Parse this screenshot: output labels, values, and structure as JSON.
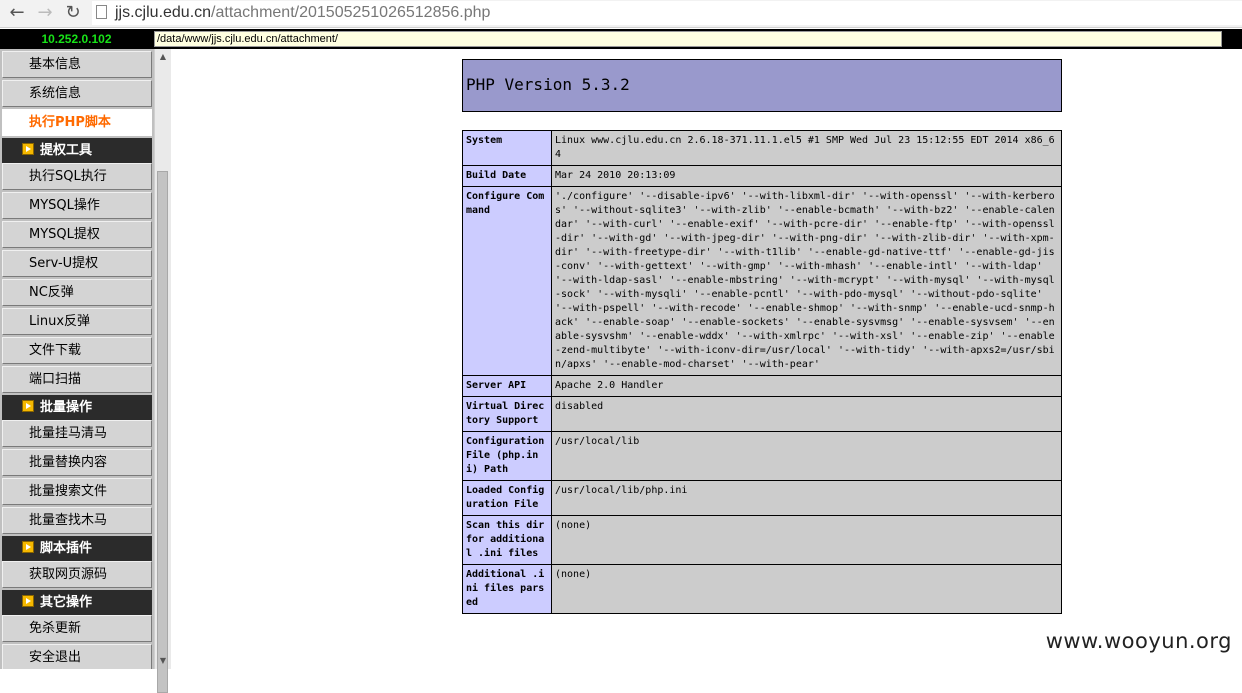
{
  "browser": {
    "url_host": "jjs.cjlu.edu.cn",
    "url_path": "/attachment/201505251026512856.php",
    "back_icon": "back-arrow-icon",
    "forward_icon": "forward-arrow-icon",
    "reload_icon": "reload-icon"
  },
  "topbar": {
    "ip": "10.252.0.102",
    "path": "/data/www/jjs.cjlu.edu.cn/attachment/",
    "ip_color": "#18e318"
  },
  "sidebar": {
    "items": [
      {
        "type": "item",
        "label": "基本信息"
      },
      {
        "type": "item",
        "label": "系统信息"
      },
      {
        "type": "item",
        "label": "执行PHP脚本",
        "active": true
      },
      {
        "type": "header",
        "label": "提权工具"
      },
      {
        "type": "item",
        "label": "执行SQL执行"
      },
      {
        "type": "item",
        "label": "MYSQL操作"
      },
      {
        "type": "item",
        "label": "MYSQL提权"
      },
      {
        "type": "item",
        "label": "Serv-U提权"
      },
      {
        "type": "item",
        "label": "NC反弹"
      },
      {
        "type": "item",
        "label": "Linux反弹"
      },
      {
        "type": "item",
        "label": "文件下载"
      },
      {
        "type": "item",
        "label": "端口扫描"
      },
      {
        "type": "header",
        "label": "批量操作"
      },
      {
        "type": "item",
        "label": "批量挂马清马"
      },
      {
        "type": "item",
        "label": "批量替换内容"
      },
      {
        "type": "item",
        "label": "批量搜索文件"
      },
      {
        "type": "item",
        "label": "批量查找木马"
      },
      {
        "type": "header",
        "label": "脚本插件"
      },
      {
        "type": "item",
        "label": "获取网页源码"
      },
      {
        "type": "header",
        "label": "其它操作"
      },
      {
        "type": "item",
        "label": "免杀更新"
      },
      {
        "type": "item",
        "label": "安全退出"
      }
    ]
  },
  "phpinfo": {
    "title": "PHP Version 5.3.2",
    "header_color": "#9999cc",
    "key_color": "#ccccff",
    "value_color": "#cccccc",
    "rows": [
      {
        "key": "System",
        "value": "Linux www.cjlu.edu.cn 2.6.18-371.11.1.el5 #1 SMP Wed Jul 23 15:12:55 EDT 2014 x86_64"
      },
      {
        "key": "Build Date",
        "value": "Mar 24 2010 20:13:09"
      },
      {
        "key": "Configure Command",
        "value": "'./configure' '--disable-ipv6' '--with-libxml-dir' '--with-openssl' '--with-kerberos' '--without-sqlite3' '--with-zlib' '--enable-bcmath' '--with-bz2' '--enable-calendar' '--with-curl' '--enable-exif' '--with-pcre-dir' '--enable-ftp' '--with-openssl-dir' '--with-gd' '--with-jpeg-dir' '--with-png-dir' '--with-zlib-dir' '--with-xpm-dir' '--with-freetype-dir' '--with-t1lib' '--enable-gd-native-ttf' '--enable-gd-jis-conv' '--with-gettext' '--with-gmp' '--with-mhash' '--enable-intl' '--with-ldap' '--with-ldap-sasl' '--enable-mbstring' '--with-mcrypt' '--with-mysql' '--with-mysql-sock' '--with-mysqli' '--enable-pcntl' '--with-pdo-mysql' '--without-pdo-sqlite' '--with-pspell' '--with-recode' '--enable-shmop' '--with-snmp' '--enable-ucd-snmp-hack' '--enable-soap' '--enable-sockets' '--enable-sysvmsg' '--enable-sysvsem' '--enable-sysvshm' '--enable-wddx' '--with-xmlrpc' '--with-xsl' '--enable-zip' '--enable-zend-multibyte' '--with-iconv-dir=/usr/local' '--with-tidy' '--with-apxs2=/usr/sbin/apxs' '--enable-mod-charset' '--with-pear'"
      },
      {
        "key": "Server API",
        "value": "Apache 2.0 Handler"
      },
      {
        "key": "Virtual Directory Support",
        "value": "disabled"
      },
      {
        "key": "Configuration File (php.ini) Path",
        "value": "/usr/local/lib"
      },
      {
        "key": "Loaded Configuration File",
        "value": "/usr/local/lib/php.ini"
      },
      {
        "key": "Scan this dir for additional .ini files",
        "value": "(none)"
      },
      {
        "key": "Additional .ini files parsed",
        "value": "(none)"
      }
    ]
  },
  "watermark": "www.wooyun.org"
}
